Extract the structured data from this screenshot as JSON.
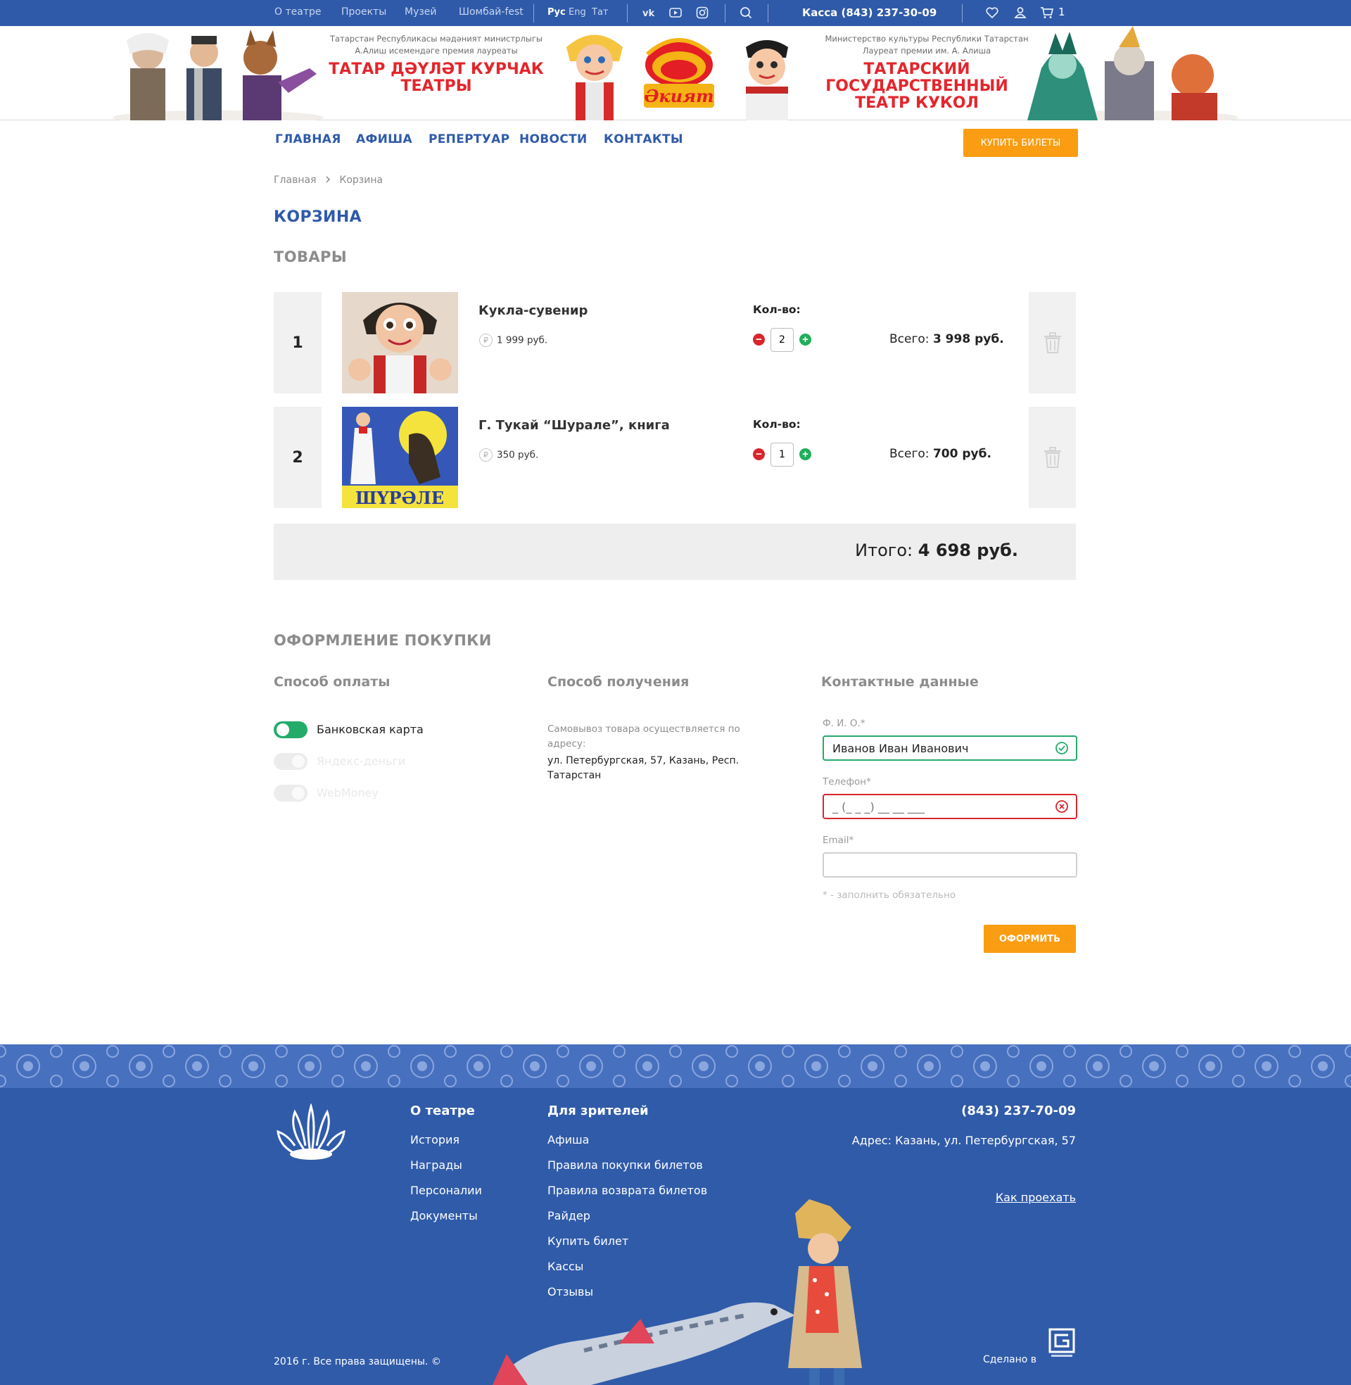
{
  "topbar": {
    "links": [
      "О театре",
      "Проекты",
      "Музей",
      "Шомбай-fest"
    ],
    "languages": [
      "Рус",
      "Eng",
      "Тат"
    ],
    "active_language": "Рус",
    "social_icons": [
      "vk-icon",
      "youtube-icon",
      "instagram-icon"
    ],
    "kassa": "Касса  (843) 237-30-09",
    "cart_count": "1"
  },
  "header": {
    "left_ministry": "Татарстан Республикасы мәдәният министрлыгы А.Алиш исемендәге премия лауреаты",
    "left_title": "ТАТАР ДӘҮЛӘТ КУРЧАК ТЕАТРЫ",
    "logo_text": "Әкият",
    "right_ministry": "Министерство культуры Республики Татарстан Лауреат премии им. А. Алиша",
    "right_title": "ТАТАРСКИЙ ГОСУДАРСТВЕННЫЙ ТЕАТР КУКОЛ"
  },
  "nav": {
    "items": [
      "ГЛАВНАЯ",
      "АФИША",
      "РЕПЕРТУАР",
      "НОВОСТИ",
      "КОНТАКТЫ"
    ],
    "buy_button": "КУПИТЬ БИЛЕТЫ"
  },
  "breadcrumb": {
    "home": "Главная",
    "current": "Корзина"
  },
  "page_title": "КОРЗИНА",
  "goods_title": "ТОВАРЫ",
  "cart": {
    "qty_label": "Кол-во:",
    "total_prefix": "Всего:",
    "items": [
      {
        "num": "1",
        "name": "Кукла-сувенир",
        "price": "1 999 руб.",
        "qty": "2",
        "total": "3 998 руб."
      },
      {
        "num": "2",
        "name": "Г. Тукай “Шурале”, книга",
        "price": "350 руб.",
        "qty": "1",
        "total": "700 руб."
      }
    ],
    "grand_prefix": "Итого:",
    "grand_total": "4 698 руб."
  },
  "checkout": {
    "title": "ОФОРМЛЕНИЕ ПОКУПКИ",
    "payment_title": "Способ оплаты",
    "payment_options": [
      {
        "label": "Банковская карта",
        "enabled": true
      },
      {
        "label": "Яндекс-деньги",
        "enabled": false
      },
      {
        "label": "WebMoney",
        "enabled": false
      }
    ],
    "delivery_title": "Способ получения",
    "delivery_note": "Самовывоз товара осуществляется по адресу:",
    "delivery_address": "ул. Петербургская, 57, Казань, Респ. Татарстан",
    "contacts_title": "Контактные данные",
    "fio_label": "Ф. И. О.*",
    "fio_value": "Иванов Иван Иванович",
    "phone_label": "Телефон*",
    "phone_value": "_ (_ _ _) __ __ ___",
    "email_label": "Email*",
    "email_value": "",
    "required_note": "* - заполнить обязательно",
    "submit": "ОФОРМИТЬ"
  },
  "footer": {
    "col1_title": "О театре",
    "col1_links": [
      "История",
      "Награды",
      "Персоналии",
      "Документы"
    ],
    "col2_title": "Для зрителей",
    "col2_links": [
      "Афиша",
      "Правила покупки билетов",
      "Правила возврата билетов",
      "Райдер",
      "Купить билет",
      "Кассы",
      "Отзывы"
    ],
    "phone": "(843) 237-70-09",
    "address": "Адрес: Казань, ул. Петербургская, 57",
    "route": "Как проехать",
    "copyright": "2016 г. Все права защищены. ©",
    "made_in": "Сделано в"
  },
  "colors": {
    "brand_blue": "#2f5aa9",
    "accent_orange": "#fa9d12",
    "title_red": "#e3262c",
    "ok_green": "#23ab6a",
    "error_red": "#d7262b"
  }
}
